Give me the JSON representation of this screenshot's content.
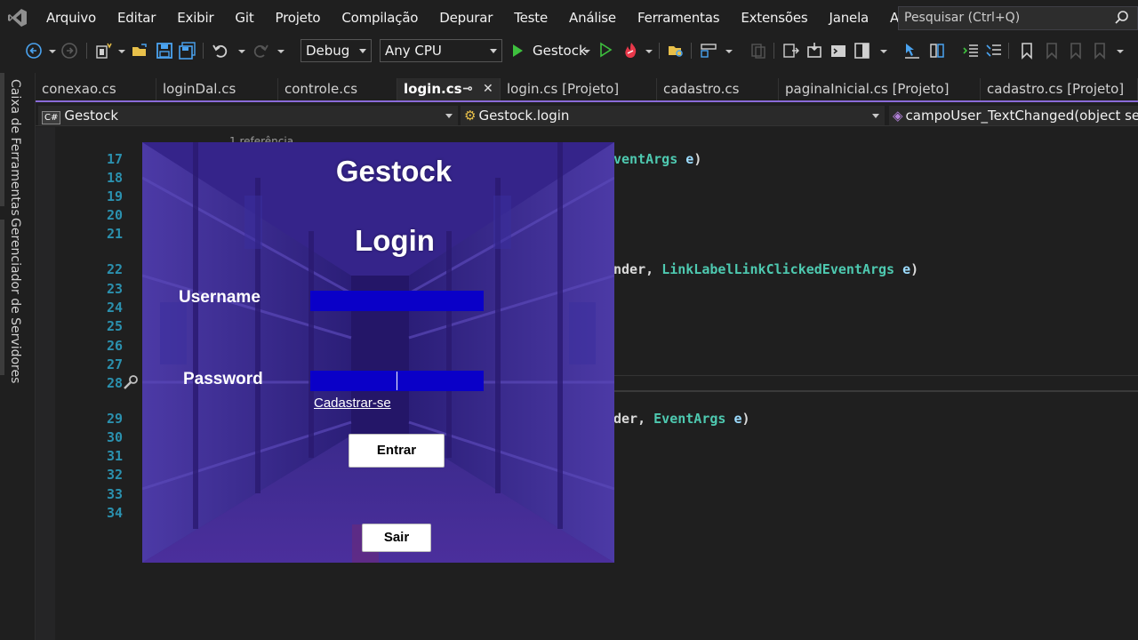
{
  "menu": {
    "items": [
      "Arquivo",
      "Editar",
      "Exibir",
      "Git",
      "Projeto",
      "Compilação",
      "Depurar",
      "Teste",
      "Análise",
      "Ferramentas",
      "Extensões",
      "Janela",
      "Ajuda"
    ],
    "search_placeholder": "Pesquisar (Ctrl+Q)"
  },
  "toolbar": {
    "configuration": "Debug",
    "platform": "Any CPU",
    "run_target": "Gestock"
  },
  "side_tabs": [
    "Caixa de Ferramentas",
    "Gerenciador de Servidores"
  ],
  "doc_tabs": [
    {
      "label": "conexao.cs"
    },
    {
      "label": "loginDal.cs"
    },
    {
      "label": "controle.cs"
    },
    {
      "label": "login.cs",
      "active": true
    },
    {
      "label": "login.cs [Projeto]"
    },
    {
      "label": "cadastro.cs"
    },
    {
      "label": "paginaInicial.cs [Projeto]"
    },
    {
      "label": "cadastro.cs [Projeto]"
    }
  ],
  "navbar": {
    "project": "Gestock",
    "class": "Gestock.login",
    "member": "campoUser_TextChanged(object sende"
  },
  "editor": {
    "codelens": "1 referência",
    "line_numbers": [
      "17",
      "18",
      "19",
      "20",
      "21",
      "22",
      "23",
      "24",
      "25",
      "26",
      "27",
      "28",
      "29",
      "30",
      "31",
      "32",
      "33",
      "34"
    ],
    "code_fragments": {
      "l17_type": "ventArgs",
      "l17_param": "e",
      "l22_plain": "nder,",
      "l22_type": "LinkLabelLinkClickedEventArgs",
      "l22_param": "e",
      "l29_plain": "der,",
      "l29_type": "EventArgs",
      "l29_param": "e"
    }
  },
  "login_form": {
    "title": "Gestock",
    "subtitle": "Login",
    "username_label": "Username",
    "password_label": "Password",
    "register_link": "Cadastrar-se",
    "enter_button": "Entrar",
    "exit_button": "Sair"
  },
  "colors": {
    "editor_bg": "#1f1f1f",
    "line_number": "#2b91af",
    "type": "#4ec9b0",
    "form_overlay": "#3a1aa0",
    "input_bg": "#0a00c8"
  }
}
